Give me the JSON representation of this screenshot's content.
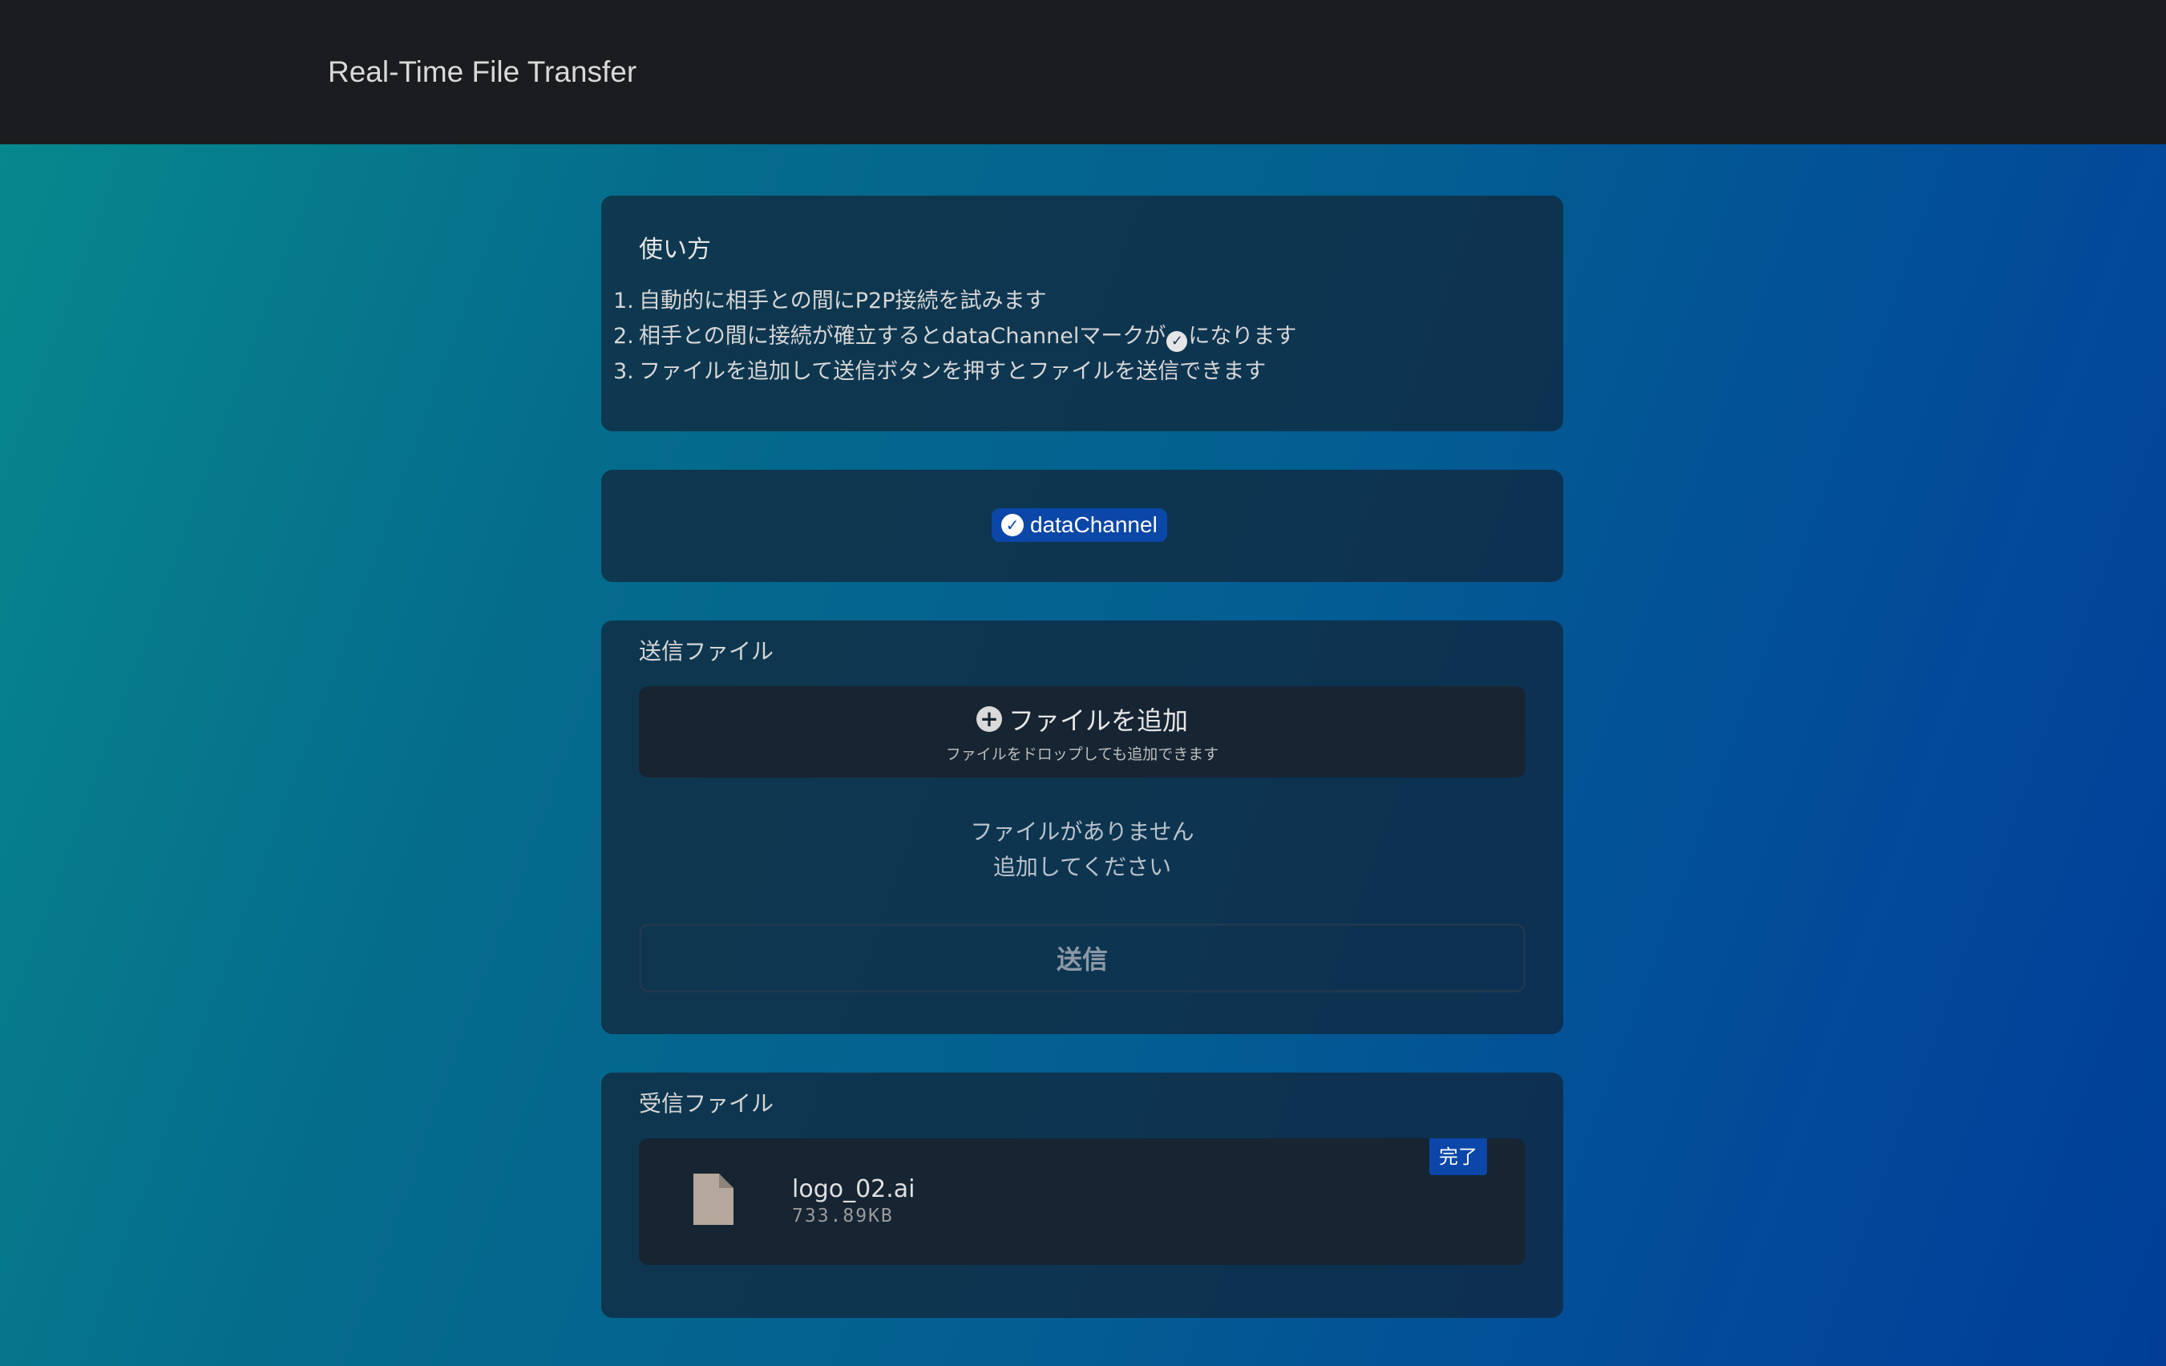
{
  "header": {
    "title": "Real-Time File Transfer"
  },
  "howto": {
    "title": "使い方",
    "steps": [
      {
        "num": "1.",
        "text": "自動的に相手との間にP2P接続を試みます"
      },
      {
        "num": "2.",
        "text_before": "相手との間に接続が確立するとdataChannelマークが",
        "text_after": "になります"
      },
      {
        "num": "3.",
        "text": "ファイルを追加して送信ボタンを押すとファイルを送信できます"
      }
    ]
  },
  "status": {
    "label": "dataChannel",
    "state": "connected"
  },
  "send": {
    "section_label": "送信ファイル",
    "add_label": "ファイルを追加",
    "add_hint": "ファイルをドロップしても追加できます",
    "empty_line1": "ファイルがありません",
    "empty_line2": "追加してください",
    "send_label": "送信"
  },
  "receive": {
    "section_label": "受信ファイル",
    "files": [
      {
        "name": "logo_02.ai",
        "size": "733.89KB",
        "status": "完了"
      }
    ]
  },
  "colors": {
    "accent": "#0b47a8",
    "header_bg": "#1b1c1f",
    "card_bg": "#122438"
  },
  "icons": {
    "check": "check-circle-icon",
    "plus": "plus-circle-icon",
    "file": "file-icon"
  }
}
